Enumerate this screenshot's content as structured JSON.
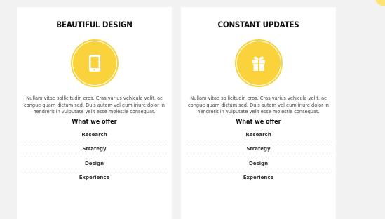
{
  "cards": [
    {
      "title": "BEAUTIFUL DESIGN",
      "icon": "tablet-icon",
      "description": "Nullam vitae sollicitudin eros. Cras varius vehicula velit, ac congue quam dictum sed. Duis autem vel eum iriure dolor in hendrerit in vulputate velit esse molestie consequat.",
      "offer_title": "What we offer",
      "offers": [
        "Research",
        "Strategy",
        "Design",
        "Experience"
      ]
    },
    {
      "title": "CONSTANT UPDATES",
      "icon": "gift-icon",
      "description": "Nullam vitae sollicitudin eros. Cras varius vehicula velit, ac congue quam dictum sed. Duis autem vel eum iriure dolor in hendrerit in vulputate velit esse molestie consequat.",
      "offer_title": "What we offer",
      "offers": [
        "Research",
        "Strategy",
        "Design",
        "Experience"
      ]
    }
  ],
  "colors": {
    "accent": "#f9d23c",
    "card_background": "#ffffff",
    "page_background": "#f2f2f2"
  }
}
